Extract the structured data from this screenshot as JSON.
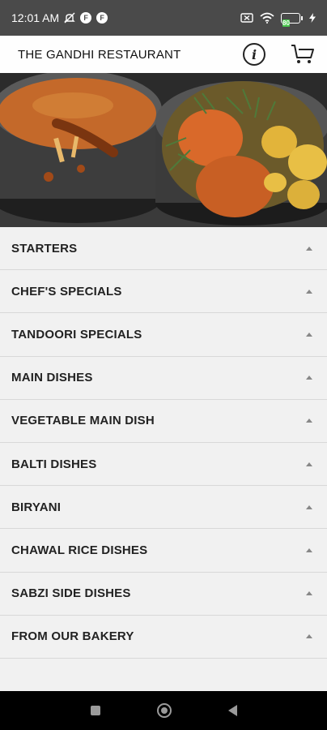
{
  "status_bar": {
    "time": "12:01 AM",
    "notification_icons": [
      "F",
      "F"
    ],
    "battery_level": "80",
    "battery_color": "#46c84a"
  },
  "header": {
    "title": "THE GANDHI RESTAURANT",
    "info_icon": "info-icon",
    "cart_icon": "cart-icon"
  },
  "menu": {
    "items": [
      {
        "label": "STARTERS"
      },
      {
        "label": "CHEF'S SPECIALS"
      },
      {
        "label": "TANDOORI SPECIALS"
      },
      {
        "label": "MAIN DISHES"
      },
      {
        "label": "VEGETABLE MAIN DISH"
      },
      {
        "label": "BALTI DISHES"
      },
      {
        "label": "BIRYANI"
      },
      {
        "label": "CHAWAL RICE DISHES"
      },
      {
        "label": "SABZI SIDE DISHES"
      },
      {
        "label": "FROM OUR BAKERY"
      }
    ]
  },
  "nav": {
    "recents_icon": "square-icon",
    "home_icon": "circle-icon",
    "back_icon": "triangle-back-icon"
  }
}
